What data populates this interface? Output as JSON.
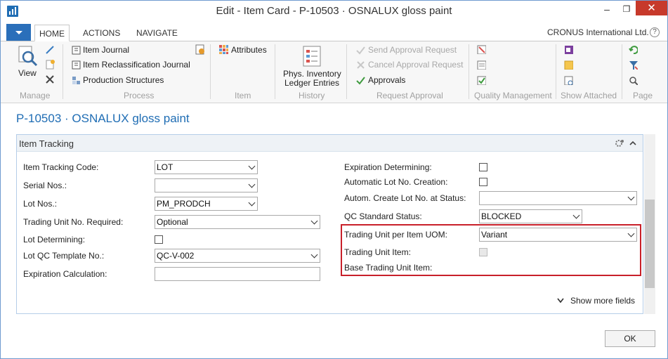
{
  "window": {
    "title": "Edit - Item Card - P-10503 · OSNALUX gloss paint",
    "minimize": "–",
    "restore": "❐",
    "close": "✕"
  },
  "tabs": [
    "HOME",
    "ACTIONS",
    "NAVIGATE"
  ],
  "company": "CRONUS International Ltd.",
  "help": "?",
  "ribbon": {
    "manage": {
      "view": "View",
      "group": "Manage"
    },
    "process": {
      "item_journal": "Item Journal",
      "item_reclass": "Item Reclassification Journal",
      "production_structures": "Production Structures",
      "group": "Process"
    },
    "item": {
      "attributes": "Attributes",
      "group": "Item"
    },
    "history": {
      "phys_inv_line1": "Phys. Inventory",
      "phys_inv_line2": "Ledger Entries",
      "group": "History"
    },
    "request_approval": {
      "send": "Send Approval Request",
      "cancel": "Cancel Approval Request",
      "approvals": "Approvals",
      "group": "Request Approval"
    },
    "quality": {
      "group": "Quality Management"
    },
    "show_attached": {
      "group": "Show Attached"
    },
    "page": {
      "group": "Page"
    }
  },
  "page_title": "P-10503 · OSNALUX gloss paint",
  "fasttab": {
    "title": "Item Tracking",
    "show_more": "Show more fields"
  },
  "left_fields": [
    {
      "label": "Item Tracking Code:",
      "value": "LOT"
    },
    {
      "label": "Serial Nos.:",
      "value": ""
    },
    {
      "label": "Lot Nos.:",
      "value": "PM_PRODCH"
    },
    {
      "label": "Trading Unit No. Required:",
      "value": "Optional"
    },
    {
      "label": "Lot Determining:",
      "value": ""
    },
    {
      "label": "Lot QC Template No.:",
      "value": "QC-V-002"
    },
    {
      "label": "Expiration Calculation:",
      "value": ""
    }
  ],
  "right_fields": [
    {
      "label": "Expiration Determining:",
      "value": ""
    },
    {
      "label": "Automatic Lot No. Creation:",
      "value": ""
    },
    {
      "label": "Autom. Create Lot No. at Status:",
      "value": ""
    },
    {
      "label": "QC Standard Status:",
      "value": "BLOCKED"
    },
    {
      "label": "Trading Unit per Item UOM:",
      "value": "Variant"
    },
    {
      "label": "Trading Unit Item:",
      "value": ""
    },
    {
      "label": "Base Trading Unit Item:",
      "value": ""
    }
  ],
  "ok_button": "OK"
}
